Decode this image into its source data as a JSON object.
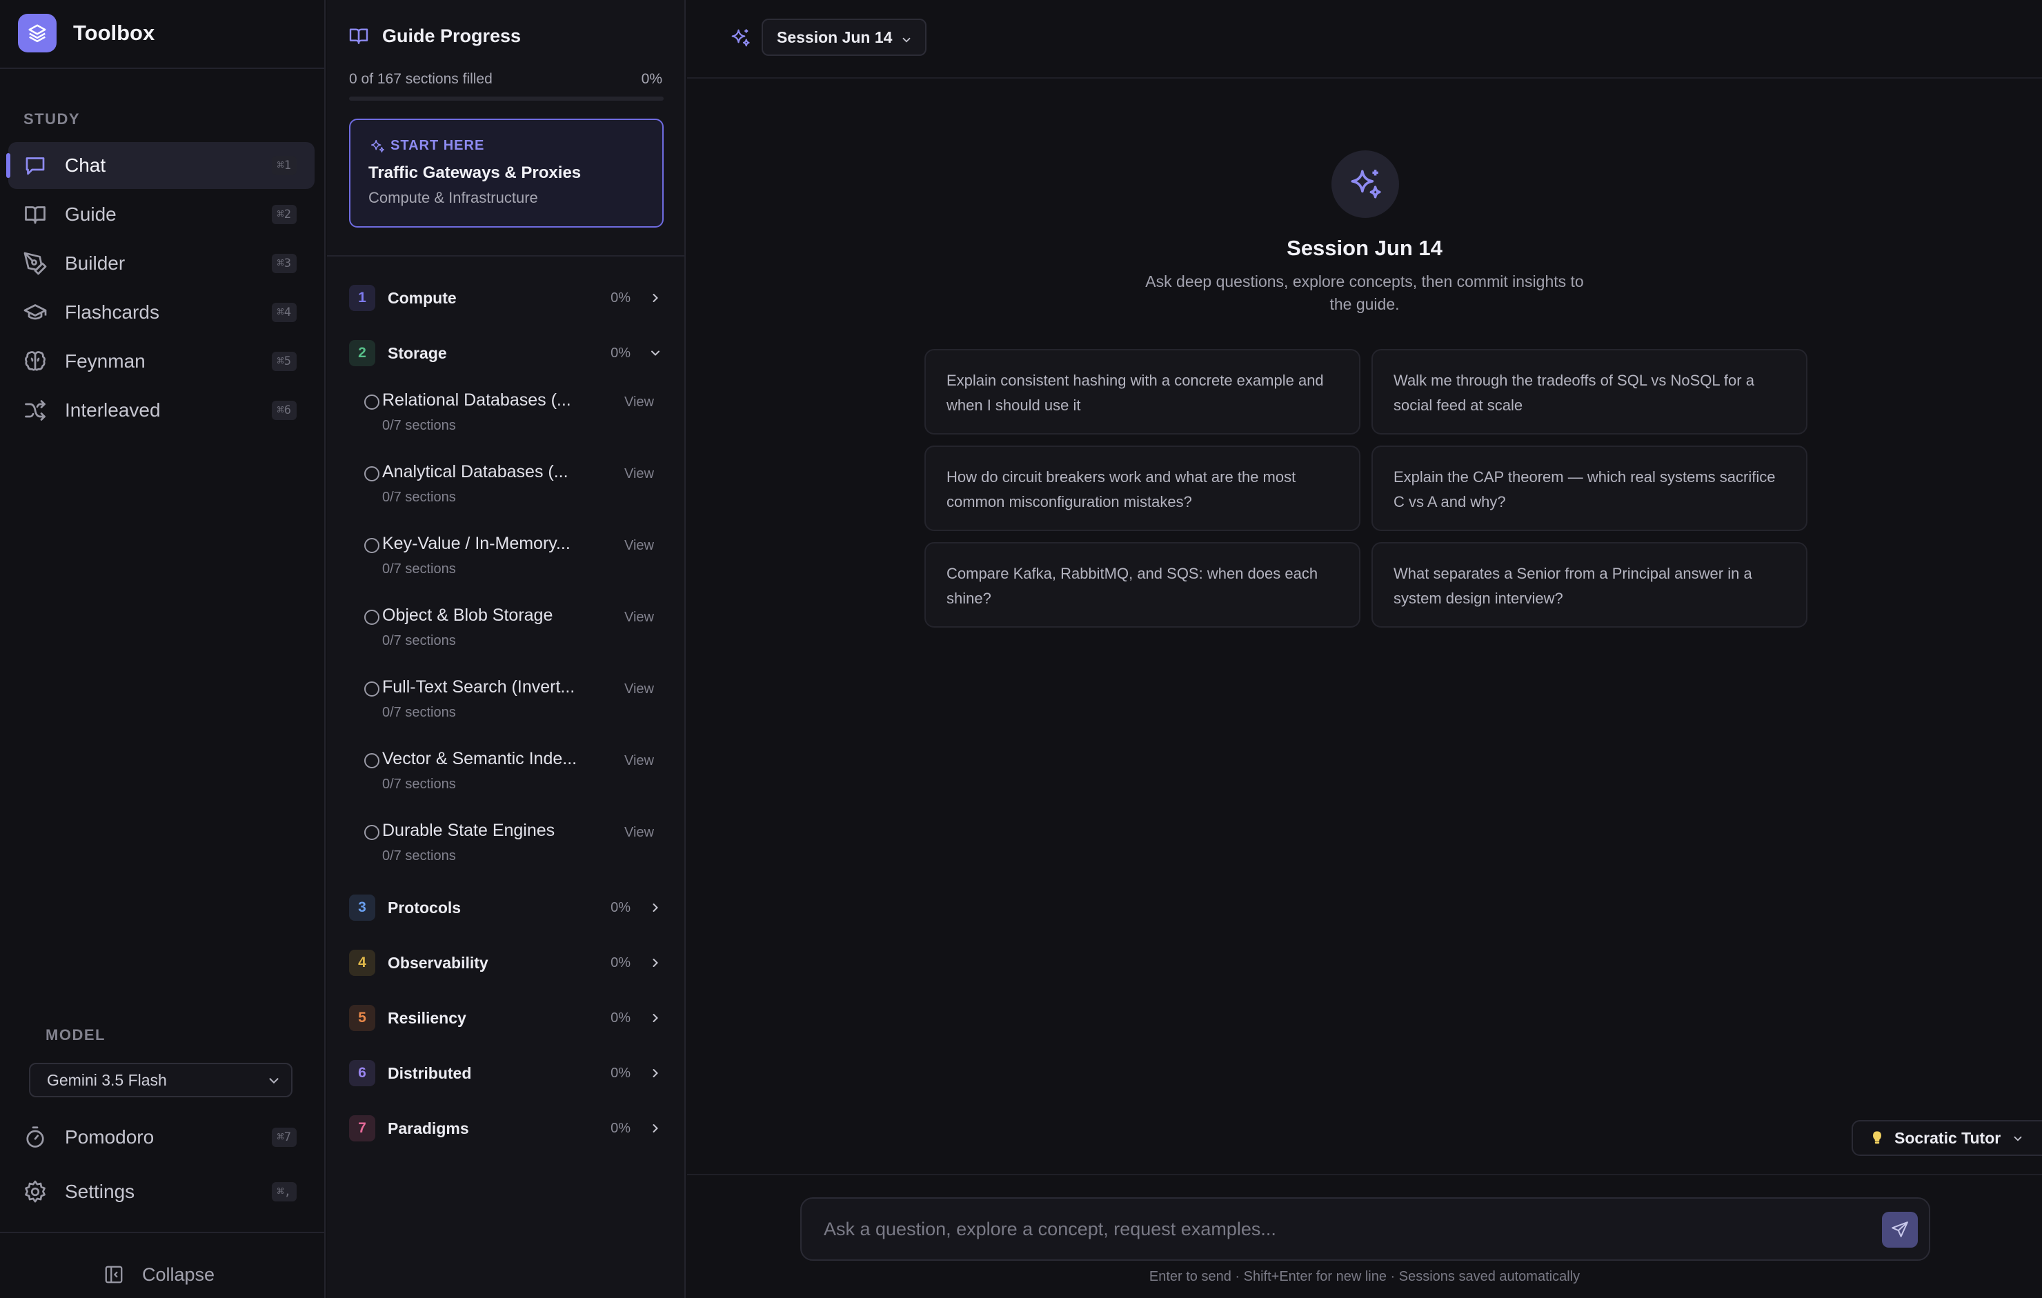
{
  "app": {
    "name": "Toolbox"
  },
  "sidebar": {
    "study_label": "STUDY",
    "items": [
      {
        "label": "Chat",
        "shortcut": "⌘1",
        "active": true
      },
      {
        "label": "Guide",
        "shortcut": "⌘2"
      },
      {
        "label": "Builder",
        "shortcut": "⌘3"
      },
      {
        "label": "Flashcards",
        "shortcut": "⌘4"
      },
      {
        "label": "Feynman",
        "shortcut": "⌘5"
      },
      {
        "label": "Interleaved",
        "shortcut": "⌘6"
      }
    ],
    "model_label": "MODEL",
    "model_selected": "Gemini 3.5 Flash",
    "bottom_items": [
      {
        "label": "Pomodoro",
        "shortcut": "⌘7"
      },
      {
        "label": "Settings",
        "shortcut": "⌘,"
      }
    ],
    "collapse_label": "Collapse"
  },
  "guide": {
    "title": "Guide Progress",
    "progress_text": "0 of 167 sections filled",
    "progress_pct": "0%",
    "progress_fraction": 0,
    "start_card": {
      "kicker": "START HERE",
      "title": "Traffic Gateways & Proxies",
      "subtitle": "Compute & Infrastructure"
    },
    "categories": [
      {
        "num": "1",
        "name": "Compute",
        "pct": "0%"
      },
      {
        "num": "2",
        "name": "Storage",
        "pct": "0%"
      },
      {
        "num": "3",
        "name": "Protocols",
        "pct": "0%"
      },
      {
        "num": "4",
        "name": "Observability",
        "pct": "0%"
      },
      {
        "num": "5",
        "name": "Resiliency",
        "pct": "0%"
      },
      {
        "num": "6",
        "name": "Distributed",
        "pct": "0%"
      },
      {
        "num": "7",
        "name": "Paradigms",
        "pct": "0%"
      }
    ],
    "storage_items": [
      {
        "title": "Relational Databases (...",
        "meta": "0/7 sections",
        "view": "View"
      },
      {
        "title": "Analytical Databases (...",
        "meta": "0/7 sections",
        "view": "View"
      },
      {
        "title": "Key-Value / In-Memory...",
        "meta": "0/7 sections",
        "view": "View"
      },
      {
        "title": "Object & Blob Storage",
        "meta": "0/7 sections",
        "view": "View"
      },
      {
        "title": "Full-Text Search (Invert...",
        "meta": "0/7 sections",
        "view": "View"
      },
      {
        "title": "Vector & Semantic Inde...",
        "meta": "0/7 sections",
        "view": "View"
      },
      {
        "title": "Durable State Engines",
        "meta": "0/7 sections",
        "view": "View"
      }
    ]
  },
  "main": {
    "session_label": "Session Jun 14",
    "hero_title": "Session Jun 14",
    "hero_subtitle": "Ask deep questions, explore concepts, then commit insights to the guide.",
    "prompts": [
      "Explain consistent hashing with a concrete example and when I should use it",
      "Walk me through the tradeoffs of SQL vs NoSQL for a social feed at scale",
      "How do circuit breakers work and what are the most common misconfiguration mistakes?",
      "Explain the CAP theorem — which real systems sacrifice C vs A and why?",
      "Compare Kafka, RabbitMQ, and SQS: when does each shine?",
      "What separates a Senior from a Principal answer in a system design interview?"
    ],
    "mode_label": "Socratic Tutor",
    "composer_placeholder": "Ask a question, explore a concept, request examples...",
    "hint": "Enter to send · Shift+Enter for new line · Sessions saved automatically"
  },
  "colors": {
    "accent": "#7b78f0",
    "cat_1": "#7e7bf0",
    "cat_2": "#58c08a",
    "cat_3": "#6aa0f0",
    "cat_4": "#e0b84a",
    "cat_5": "#e8884a",
    "cat_6": "#9a86f0",
    "cat_7": "#e86a9a"
  }
}
